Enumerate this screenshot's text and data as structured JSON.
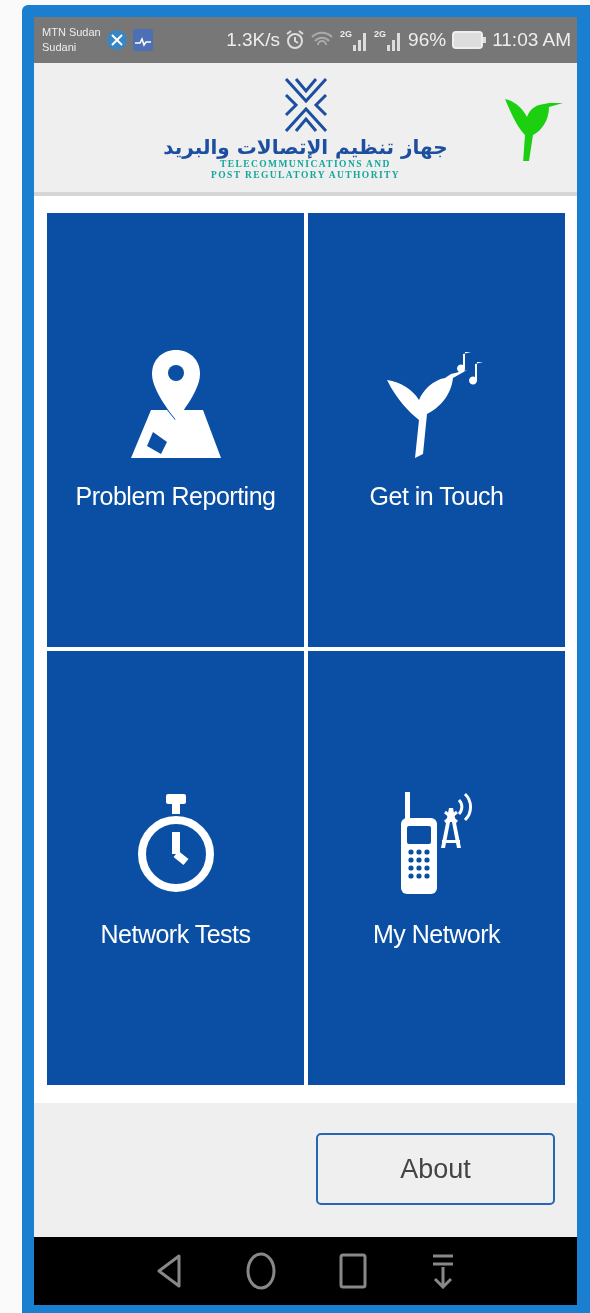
{
  "status_bar": {
    "carrier_lines": [
      "MTN Sudan",
      "Sudani"
    ],
    "speed": "1.3K/s",
    "sim_labels": [
      "2G",
      "2G"
    ],
    "battery": "96%",
    "time": "11:03 AM"
  },
  "header": {
    "arabic_name": "جهاز تنظيم الإتصالات والبريد",
    "english_name_lines": [
      "TELECOMMUNICATIONS AND",
      "POST REGULATORY AUTHORITY"
    ]
  },
  "tiles": [
    {
      "label": "Problem Reporting",
      "kind": "map-pin"
    },
    {
      "label": "Get in Touch",
      "kind": "bird"
    },
    {
      "label": "Network Tests",
      "kind": "stopwatch"
    },
    {
      "label": "My Network",
      "kind": "phone-tower"
    }
  ],
  "about_button": "About"
}
